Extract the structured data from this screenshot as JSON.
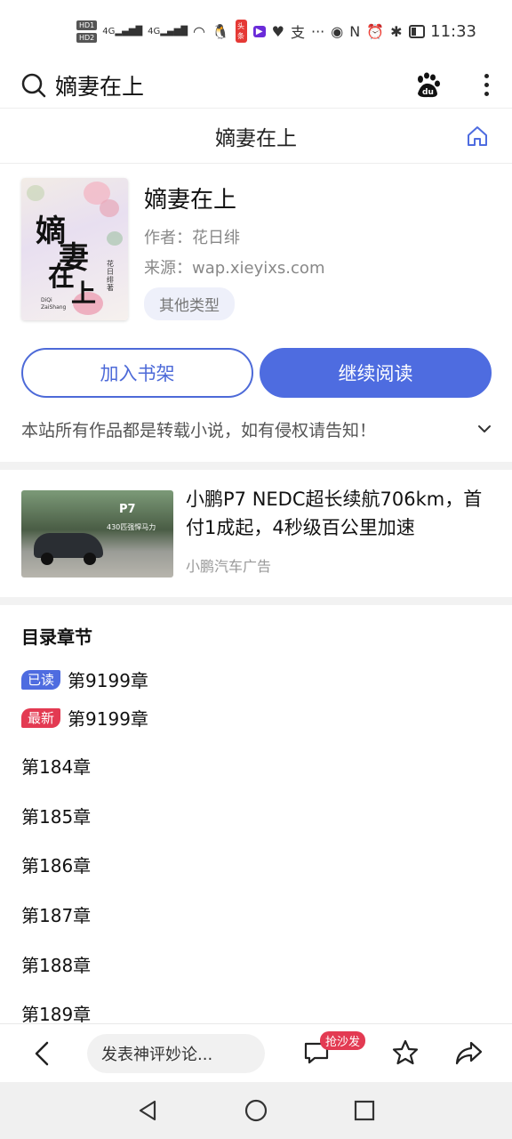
{
  "statusbar": {
    "hd1": "HD1",
    "hd2": "HD2",
    "sig1": "4G",
    "sig2": "4G",
    "app_toutiao": "头条",
    "app_pay": "支",
    "more": "···",
    "time": "11:33"
  },
  "search": {
    "query": "嫡妻在上"
  },
  "header": {
    "title": "嫡妻在上"
  },
  "book": {
    "title": "嫡妻在上",
    "author": "作者：花日绯",
    "source": "来源：wap.xieyixs.com",
    "tag": "其他类型",
    "cover": {
      "title_chars": [
        "嫡",
        "妻",
        "在",
        "上"
      ],
      "pinyin": "DiQi\nZaiShang",
      "author_vertical": "花日绯著"
    }
  },
  "actions": {
    "add_shelf": "加入书架",
    "continue_read": "继续阅读"
  },
  "notice": "本站所有作品都是转载小说，如有侵权请告知！",
  "ad": {
    "title": "小鹏P7 NEDC超长续航706km，首付1成起，4秒级百公里加速",
    "source": "小鹏汽车广告",
    "img_brand": "P7",
    "img_slogan": "430匹强悍马力"
  },
  "toc": {
    "heading": "目录章节",
    "read_badge": "已读",
    "read_chapter": "第9199章",
    "new_badge": "最新",
    "new_chapter": "第9199章",
    "chapters": [
      "第184章",
      "第185章",
      "第186章",
      "第187章",
      "第188章",
      "第189章"
    ]
  },
  "bottom": {
    "comment_placeholder": "发表神评妙论...",
    "sofa_badge": "抢沙发"
  },
  "colors": {
    "accent": "#4e6ce0",
    "new_badge": "#e33a52"
  }
}
